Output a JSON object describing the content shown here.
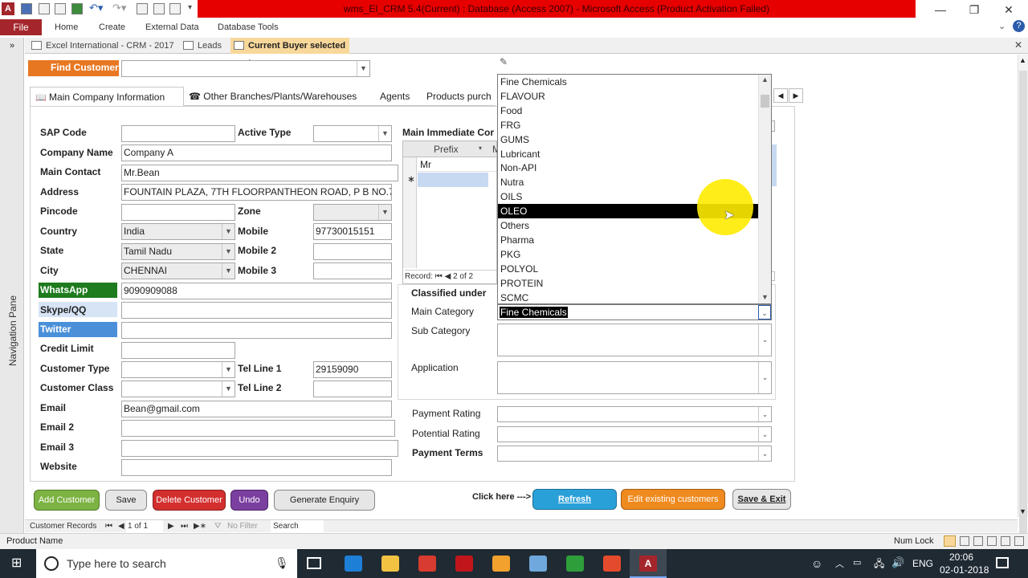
{
  "window": {
    "title": "wms_EI_CRM 5.4(Current) : Database (Access 2007) - Microsoft Access (Product Activation Failed)",
    "minimize": "—",
    "restore": "❐",
    "close": "✕"
  },
  "ribbon": {
    "file": "File",
    "tabs": [
      "Home",
      "Create",
      "External Data",
      "Database Tools"
    ]
  },
  "navigation_pane": {
    "label": "Navigation Pane",
    "toggle": "»"
  },
  "doc_tabs": [
    "Excel International - CRM - 2017",
    "Leads",
    "Current Buyer selected :"
  ],
  "find_customer": {
    "label": "Find Customer",
    "value": ""
  },
  "form_tabs": [
    "Main Company Information",
    "Other Branches/Plants/Warehouses",
    "Agents",
    "Products purch"
  ],
  "fields": {
    "sap_code": {
      "label": "SAP Code",
      "value": ""
    },
    "active_type": {
      "label": "Active Type",
      "value": ""
    },
    "company_name": {
      "label": "Company Name",
      "value": "Company A"
    },
    "main_contact": {
      "label": "Main Contact",
      "value": "Mr.Bean"
    },
    "address": {
      "label": "Address",
      "value": "FOUNTAIN PLAZA, 7TH FLOORPANTHEON ROAD, P B NO.75"
    },
    "pincode": {
      "label": "Pincode",
      "value": ""
    },
    "zone": {
      "label": "Zone",
      "value": ""
    },
    "country": {
      "label": "Country",
      "value": "India"
    },
    "mobile": {
      "label": "Mobile",
      "value": "97730015151"
    },
    "state": {
      "label": "State",
      "value": "Tamil Nadu"
    },
    "mobile2": {
      "label": "Mobile 2",
      "value": ""
    },
    "city": {
      "label": "City",
      "value": "CHENNAI"
    },
    "mobile3": {
      "label": "Mobile 3",
      "value": ""
    },
    "whatsapp": {
      "label": "WhatsApp",
      "value": "9090909088"
    },
    "skype": {
      "label": "Skype/QQ",
      "value": ""
    },
    "twitter": {
      "label": "Twitter",
      "value": ""
    },
    "credit_limit": {
      "label": "Credit Limit",
      "value": ""
    },
    "customer_type": {
      "label": "Customer Type",
      "value": ""
    },
    "tel1": {
      "label": "Tel Line 1",
      "value": "29159090"
    },
    "customer_class": {
      "label": "Customer Class",
      "value": ""
    },
    "tel2": {
      "label": "Tel Line 2",
      "value": ""
    },
    "email": {
      "label": "Email",
      "value": "Bean@gmail.com"
    },
    "email2": {
      "label": "Email 2",
      "value": ""
    },
    "email3": {
      "label": "Email 3",
      "value": ""
    },
    "website": {
      "label": "Website",
      "value": ""
    }
  },
  "contacts": {
    "title": "Main Immediate Cor",
    "col_prefix": "Prefix",
    "col_m": "M",
    "rows": [
      "Mr"
    ],
    "new_row_marker": "∗",
    "record_label": "Record:",
    "record_pos": "2 of 2"
  },
  "classification": {
    "title": "Classified under",
    "main_category": {
      "label": "Main Category",
      "value": "Fine Chemicals"
    },
    "sub_category": {
      "label": "Sub Category",
      "value": ""
    },
    "application": {
      "label": "Application",
      "value": ""
    }
  },
  "category_list": {
    "items": [
      "Fine Chemicals",
      "FLAVOUR",
      "Food",
      "FRG",
      "GUMS",
      "Lubricant",
      "Non-API",
      "Nutra",
      "OILS",
      "OLEO",
      "Others",
      "Pharma",
      "PKG",
      "POLYOL",
      "PROTEIN",
      "SCMC"
    ],
    "selected": "OLEO"
  },
  "ratings": {
    "payment_rating": {
      "label": "Payment Rating",
      "value": ""
    },
    "potential_rating": {
      "label": "Potential Rating",
      "value": ""
    },
    "payment_terms": {
      "label": "Payment Terms",
      "value": ""
    }
  },
  "buttons": {
    "add_customer": "Add Customer",
    "save": "Save",
    "delete_customer": "Delete Customer",
    "undo": "Undo",
    "generate_enquiry": "Generate Enquiry",
    "click_here": "Click here --->",
    "refresh": "Refresh",
    "edit_existing": "Edit existing customers",
    "save_exit": "Save & Exit"
  },
  "record_nav": {
    "label": "Customer Records",
    "position": "1 of 1",
    "filter": "No Filter",
    "search": "Search"
  },
  "statusbar": {
    "left": "Product Name",
    "num_lock": "Num Lock"
  },
  "taskbar": {
    "search_placeholder": "Type here to search",
    "lang": "ENG",
    "time": "20:06",
    "date": "02-01-2018"
  },
  "colors": {
    "whatsapp": "#1e7b1e",
    "twitter": "#4a90d9",
    "find_customer": "#e87722",
    "file_tab": "#a4262c",
    "title_bar": "#e60000"
  }
}
